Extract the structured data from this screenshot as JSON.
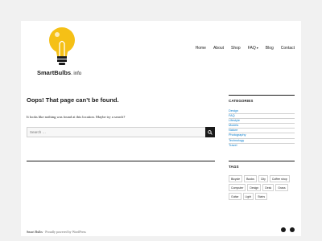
{
  "header": {
    "brand_name": "SmartBulbs",
    "brand_suffix": ". info"
  },
  "nav": [
    "Home",
    "About",
    "Shop",
    "FAQ",
    "Blog",
    "Contact"
  ],
  "main": {
    "title": "Oops! That page can’t be found.",
    "message": "It looks like nothing was found at this location. Maybe try a search?",
    "search_placeholder": "Search …"
  },
  "sidebar": {
    "categories_title": "CATEGORIES",
    "categories": [
      "Design",
      "FAQ",
      "Lifestyle",
      "Models",
      "Nature",
      "Photography",
      "Technology",
      "Travel"
    ],
    "tags_title": "TAGS",
    "tags": [
      "Bicycle",
      "Books",
      "City",
      "Coffee shop",
      "Computer",
      "Design",
      "Desk",
      "Grass",
      "Guitar",
      "Light",
      "Stairs"
    ]
  },
  "footer": {
    "site_name": "Smart Bulbs",
    "powered_by": "Proudly powered by WordPress"
  },
  "colors": {
    "background": "#f1f1f1",
    "content": "#ffffff",
    "link": "#007acc",
    "text": "#1a1a1a",
    "bulb": "#f5c016"
  }
}
